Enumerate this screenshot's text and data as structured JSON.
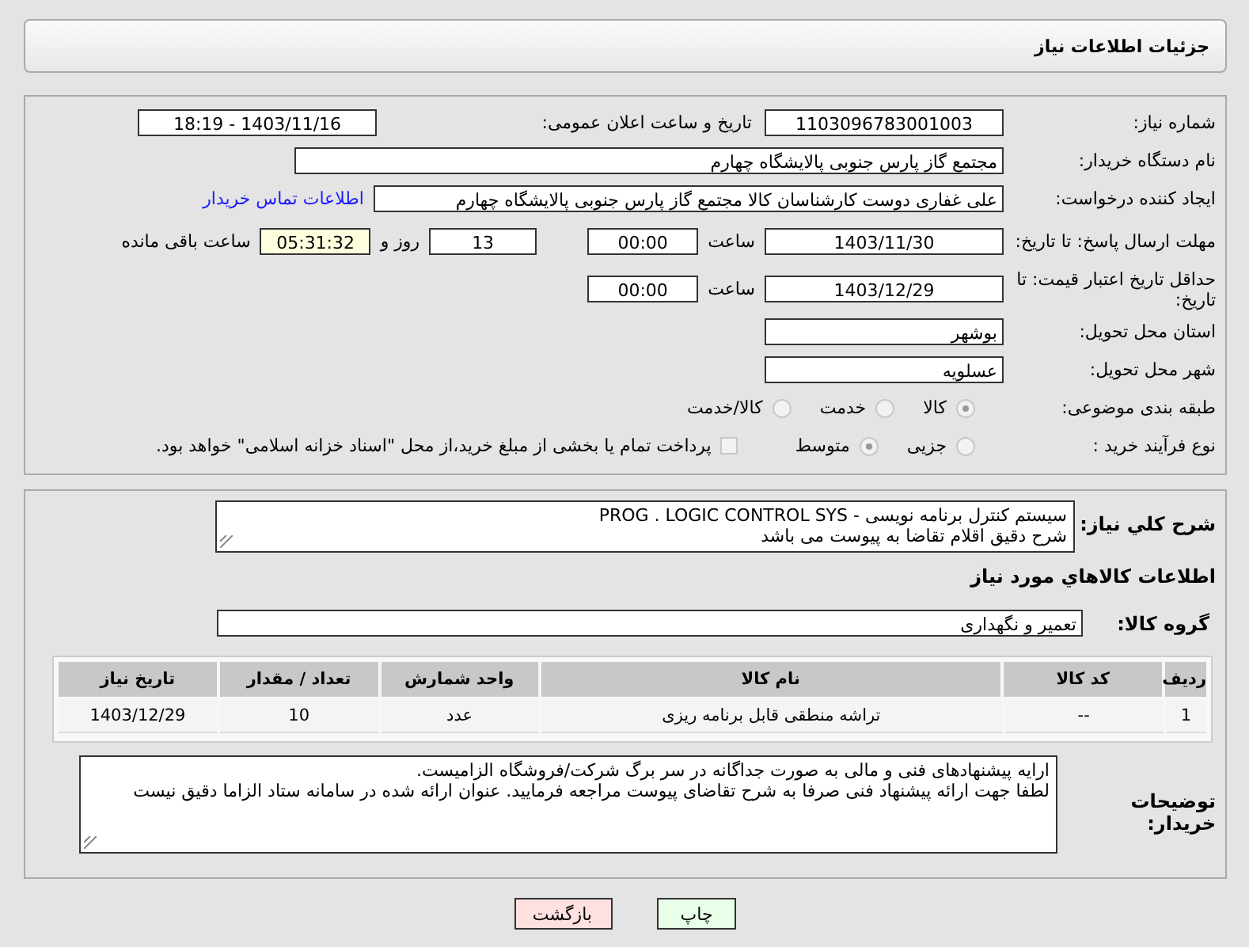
{
  "header": {
    "title": "جزئیات اطلاعات نیاز"
  },
  "need_number": {
    "label": "شماره نیاز:",
    "value": "1103096783001003"
  },
  "announce": {
    "label": "تاریخ و ساعت اعلان عمومی:",
    "value": "1403/11/16 - 18:19"
  },
  "buyer": {
    "label": "نام دستگاه خریدار:",
    "value": "مجتمع گاز پارس جنوبی  پالایشگاه چهارم"
  },
  "creator": {
    "label": "ایجاد کننده درخواست:",
    "value": "علی غفاری دوست کارشناسان کالا مجتمع گاز پارس جنوبی  پالایشگاه چهارم",
    "link": "اطلاعات تماس خریدار"
  },
  "deadline": {
    "label": "مهلت ارسال پاسخ: تا تاریخ:",
    "date": "1403/11/30",
    "time_label": "ساعت",
    "time": "00:00",
    "days": "13",
    "days_label": "روز و",
    "remaining": "05:31:32",
    "remaining_label": "ساعت باقی مانده"
  },
  "validity": {
    "label": "حداقل تاریخ اعتبار قیمت: تا تاریخ:",
    "date": "1403/12/29",
    "time_label": "ساعت",
    "time": "00:00"
  },
  "province": {
    "label": "استان محل تحویل:",
    "value": "بوشهر"
  },
  "city": {
    "label": "شهر محل تحویل:",
    "value": "عسلویه"
  },
  "classification": {
    "label": "طبقه بندی موضوعی:",
    "options": [
      {
        "label": "کالا",
        "selected": true
      },
      {
        "label": "خدمت",
        "selected": false
      },
      {
        "label": "کالا/خدمت",
        "selected": false
      }
    ]
  },
  "process": {
    "label": "نوع فرآیند خرید :",
    "options": [
      {
        "label": "جزیی",
        "selected": false
      },
      {
        "label": "متوسط",
        "selected": true
      }
    ],
    "treasury": {
      "label": "پرداخت تمام یا بخشی از مبلغ خرید،از محل \"اسناد خزانه اسلامی\" خواهد بود.",
      "checked": false
    }
  },
  "description": {
    "label": "شرح کلي نياز:",
    "lines": [
      "سیستم کنترل برنامه نویسی - PROG . LOGIC CONTROL SYS",
      "شرح دقیق اقلام تقاضا به پیوست می باشد"
    ]
  },
  "items_heading": "اطلاعات کالاهاي مورد نياز",
  "group": {
    "label": "گروه کالا:",
    "value": "تعمیر و نگهداری"
  },
  "table": {
    "columns": [
      "ردیف",
      "کد کالا",
      "نام کالا",
      "واحد شمارش",
      "تعداد / مقدار",
      "تاریخ نیاز"
    ],
    "rows": [
      [
        "1",
        "--",
        "تراشه منطقی قابل برنامه ریزی",
        "عدد",
        "10",
        "1403/12/29"
      ]
    ]
  },
  "notes": {
    "label": "توضیحات خریدار:",
    "lines": [
      "ارایه پیشنهادهای فنی و مالی به صورت جداگانه در سر برگ شرکت/فروشگاه الزامیست.",
      "لطفا جهت ارائه پیشنهاد فنی صرفا به شرح تقاضای پیوست مراجعه فرمایید. عنوان ارائه شده در سامانه ستاد الزاما دقیق نیست"
    ]
  },
  "buttons": [
    {
      "label": "چاپ",
      "kind": "print"
    },
    {
      "label": "بازگشت",
      "kind": "back"
    }
  ]
}
